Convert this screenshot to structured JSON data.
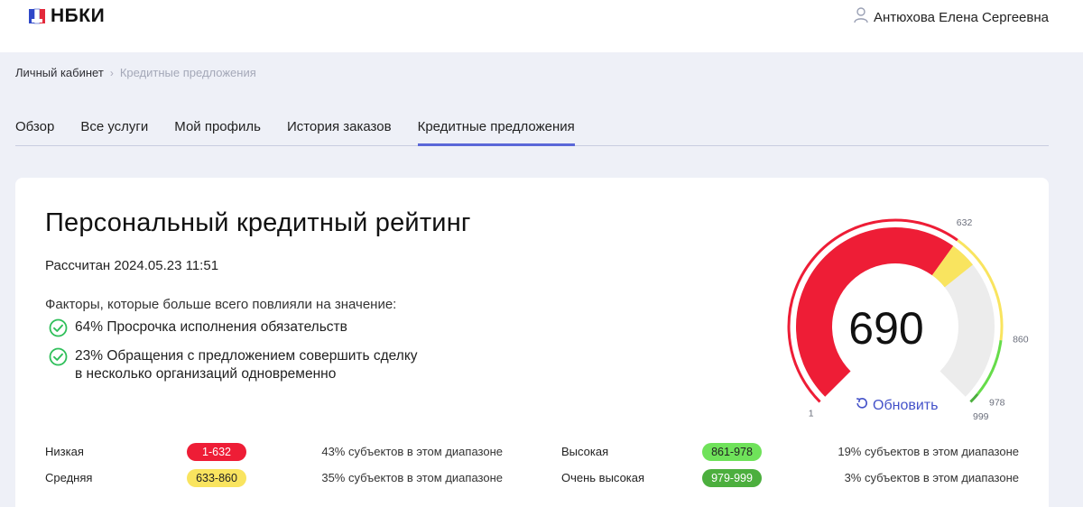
{
  "header": {
    "logo_text": "НБКИ",
    "user_name": "Антюхова Елена Сергеевна"
  },
  "breadcrumb": {
    "root": "Личный кабинет",
    "separator": "›",
    "current": "Кредитные предложения"
  },
  "tabs": [
    {
      "label": "Обзор"
    },
    {
      "label": "Все услуги"
    },
    {
      "label": "Мой профиль"
    },
    {
      "label": "История заказов"
    },
    {
      "label": "Кредитные предложения",
      "active": true
    }
  ],
  "rating": {
    "title": "Персональный кредитный рейтинг",
    "calculated": "Рассчитан 2024.05.23 11:51",
    "factors_heading": "Факторы, которые больше всего повлияли на значение:",
    "factors": [
      {
        "line1": "64% Просрочка исполнения обязательств",
        "line2": ""
      },
      {
        "line1": "23% Обращения с предложением совершить сделку",
        "line2": "в несколько организаций одновременно"
      }
    ]
  },
  "gauge": {
    "value": "690",
    "score": 690,
    "min": 1,
    "max": 999,
    "labels": {
      "min": "1",
      "b1": "632",
      "b2": "860",
      "b3": "978",
      "max": "999"
    },
    "refresh_label": "Обновить",
    "colors": {
      "low": "#ee1d36",
      "medium": "#f9e45f",
      "high": "#66dc4a",
      "very_high": "#4caf3e",
      "track": "#ececec"
    }
  },
  "legend": [
    {
      "name": "Низкая",
      "range": "1-632",
      "share": "43% субъектов в этом диапазоне",
      "color": "#ee1d36",
      "text_color": "#ffffff"
    },
    {
      "name": "Средняя",
      "range": "633-860",
      "share": "35% субъектов в этом диапазоне",
      "color": "#f9e45f",
      "text_color": "#222222"
    },
    {
      "name": "Высокая",
      "range": "861-978",
      "share": "19% субъектов в этом диапазоне",
      "color": "#6fe25a",
      "text_color": "#222222"
    },
    {
      "name": "Очень высокая",
      "range": "979-999",
      "share": "3% субъектов в этом диапазоне",
      "color": "#4caf3e",
      "text_color": "#ffffff"
    }
  ],
  "icons": {
    "logo": "nbki-logo-icon",
    "user": "user-icon",
    "check": "check-circle-icon",
    "refresh": "refresh-icon"
  }
}
